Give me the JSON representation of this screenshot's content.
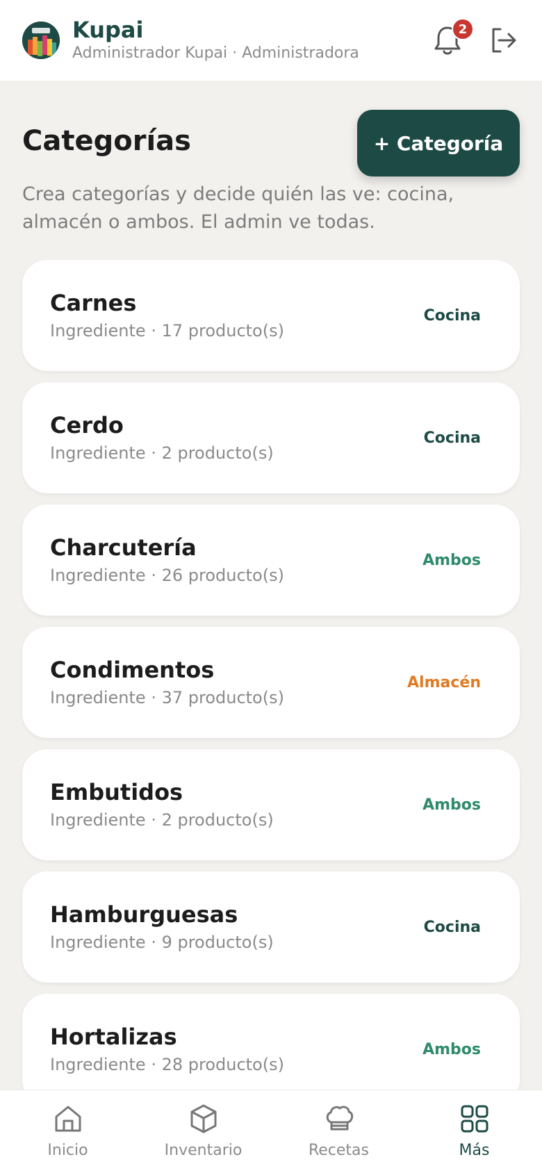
{
  "header": {
    "brand": "Kupai",
    "user_line": "Administrador Kupai · Administradora",
    "notification_count": "2",
    "logo_icon": "kupai-logo",
    "bell_icon": "bell-icon",
    "logout_icon": "logout-icon"
  },
  "page": {
    "title": "Categorías",
    "add_button": "+ Categoría",
    "description": "Crea categorías y decide quién las ve: cocina, almacén o ambos. El admin ve todas."
  },
  "colors": {
    "brand": "#1d4a45",
    "cocina": "#1d4a45",
    "ambos": "#2e8a6a",
    "almacen": "#e07b23",
    "badge": "#c7372f"
  },
  "categories": [
    {
      "name": "Carnes",
      "meta": "Ingrediente · 17 producto(s)",
      "tag": "Cocina",
      "tag_color": "#1d4a45"
    },
    {
      "name": "Cerdo",
      "meta": "Ingrediente · 2 producto(s)",
      "tag": "Cocina",
      "tag_color": "#1d4a45"
    },
    {
      "name": "Charcutería",
      "meta": "Ingrediente · 26 producto(s)",
      "tag": "Ambos",
      "tag_color": "#2e8a6a"
    },
    {
      "name": "Condimentos",
      "meta": "Ingrediente · 37 producto(s)",
      "tag": "Almacén",
      "tag_color": "#e07b23"
    },
    {
      "name": "Embutidos",
      "meta": "Ingrediente · 2 producto(s)",
      "tag": "Ambos",
      "tag_color": "#2e8a6a"
    },
    {
      "name": "Hamburguesas",
      "meta": "Ingrediente · 9 producto(s)",
      "tag": "Cocina",
      "tag_color": "#1d4a45"
    },
    {
      "name": "Hortalizas",
      "meta": "Ingrediente · 28 producto(s)",
      "tag": "Ambos",
      "tag_color": "#2e8a6a"
    }
  ],
  "nav": [
    {
      "label": "Inicio",
      "icon": "home-icon",
      "active": false
    },
    {
      "label": "Inventario",
      "icon": "box-icon",
      "active": false
    },
    {
      "label": "Recetas",
      "icon": "chef-hat-icon",
      "active": false
    },
    {
      "label": "Más",
      "icon": "grid-icon",
      "active": true
    }
  ]
}
